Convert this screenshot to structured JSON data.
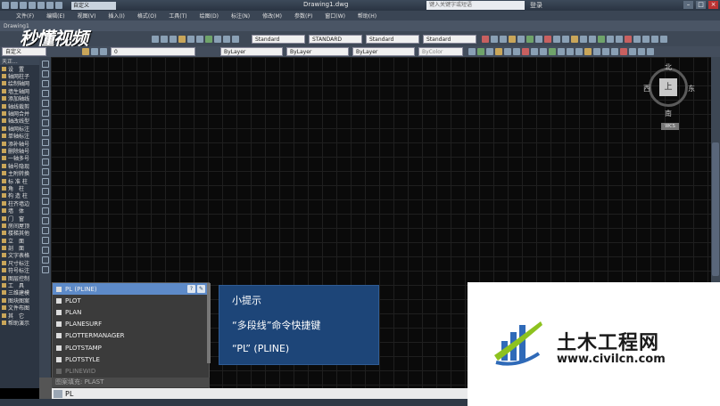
{
  "titlebar": {
    "workspace": "自定义",
    "document_title": "Drawing1.dwg",
    "search_placeholder": "键入关键字或短语",
    "login": "登录"
  },
  "menu": [
    "文件(F)",
    "编辑(E)",
    "视图(V)",
    "插入(I)",
    "格式(O)",
    "工具(T)",
    "绘图(D)",
    "标注(N)",
    "修改(M)",
    "参数(P)",
    "窗口(W)",
    "帮助(H)"
  ],
  "toolbar": {
    "drawing_tab": "Drawing1",
    "text_style": "Standard",
    "dim_style": "STANDARD",
    "table_style": "Standard",
    "multileader_style": "Standard",
    "layer": "0",
    "workspace_select": "自定义",
    "color": "ByLayer",
    "linetype": "ByLayer",
    "lineweight": "ByLayer",
    "plotstyle": "ByColor"
  },
  "watermark": "秒懂视频",
  "left_panel": {
    "header": "天正...",
    "items": [
      "设　置",
      "轴网柱子",
      "绘制轴网",
      "墙生轴网",
      "添加轴线",
      "轴线裁剪",
      "轴网合并",
      "轴改线型",
      "轴网标注",
      "单轴标注",
      "添补轴号",
      "删除轴号",
      "一轴多号",
      "轴号隐现",
      "主附转换",
      "标 准 柱",
      "角　柱",
      "构 造 柱",
      "柱齐墙边",
      "墙　体",
      "门　窗",
      "房间屋顶",
      "楼梯其他",
      "立　面",
      "剖　面",
      "文字表格",
      "尺寸标注",
      "符号标注",
      "图层控制",
      "工　具",
      "三维建模",
      "图块图案",
      "文件布图",
      "其　它",
      "帮助演示"
    ]
  },
  "viewcube": {
    "north": "北",
    "south": "南",
    "east": "东",
    "west": "西",
    "top": "上",
    "wcs": "WCS"
  },
  "autocomplete": {
    "items": [
      {
        "label": "PL (PLINE)",
        "selected": true
      },
      {
        "label": "PLOT",
        "selected": false
      },
      {
        "label": "PLAN",
        "selected": false
      },
      {
        "label": "PLANESURF",
        "selected": false
      },
      {
        "label": "PLOTTERMANAGER",
        "selected": false
      },
      {
        "label": "PLOTSTAMP",
        "selected": false
      },
      {
        "label": "PLOTSTYLE",
        "selected": false
      },
      {
        "label": "PLINEWID",
        "selected": false
      }
    ],
    "help_btn": "?",
    "settings_btn": "✎"
  },
  "command": {
    "previous": "图案填充: PLAST",
    "current": "PL"
  },
  "tip": {
    "title": "小提示",
    "line1": "“多段线”命令快捷键",
    "line2": "“PL” (PLINE)"
  },
  "brand": {
    "name": "土木工程网",
    "url": "www.civilcn.com"
  }
}
